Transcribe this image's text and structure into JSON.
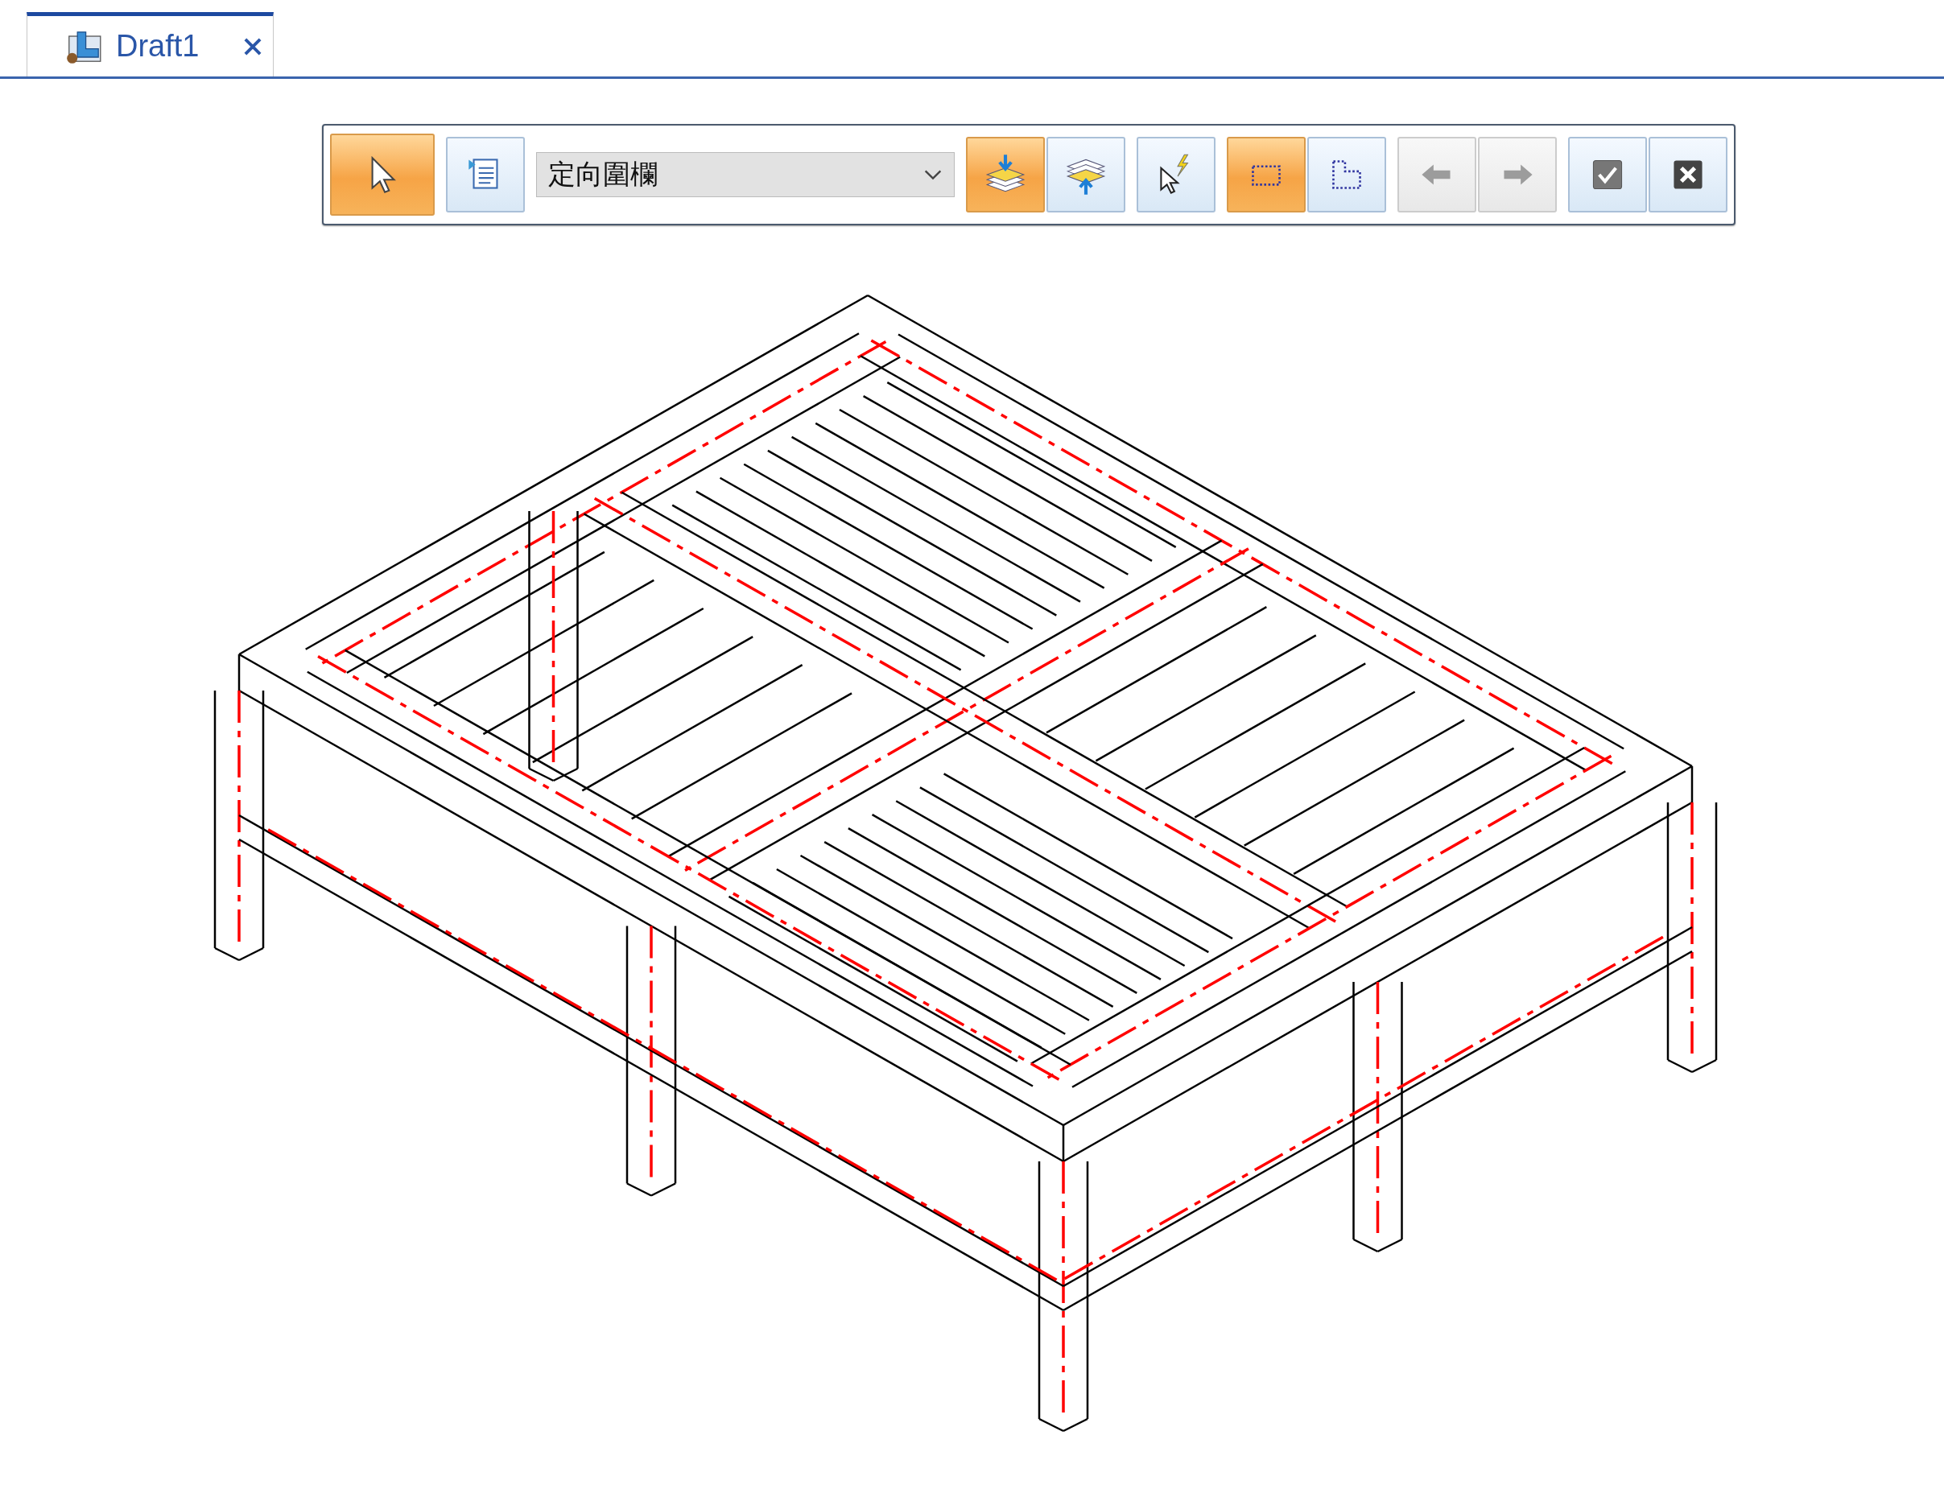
{
  "tabs": [
    {
      "label": "Draft1",
      "selected": true
    }
  ],
  "toolbar": {
    "groups": [
      [
        {
          "kind": "button",
          "selected": true,
          "disabled": false
        }
      ],
      [
        {
          "kind": "button",
          "selected": false,
          "disabled": false
        }
      ],
      [
        {
          "kind": "dropdown",
          "value": "定向圍欄"
        }
      ],
      [
        {
          "kind": "button",
          "selected": true,
          "disabled": false
        },
        {
          "kind": "button",
          "selected": false,
          "disabled": false
        }
      ],
      [
        {
          "kind": "button",
          "selected": false,
          "disabled": false
        }
      ],
      [
        {
          "kind": "button",
          "selected": true,
          "disabled": false
        },
        {
          "kind": "button",
          "selected": false,
          "disabled": false
        }
      ],
      [
        {
          "kind": "button",
          "selected": false,
          "disabled": true
        },
        {
          "kind": "button",
          "selected": false,
          "disabled": true
        }
      ],
      [
        {
          "kind": "button",
          "selected": false,
          "disabled": false
        },
        {
          "kind": "button",
          "selected": false,
          "disabled": false
        }
      ]
    ]
  }
}
